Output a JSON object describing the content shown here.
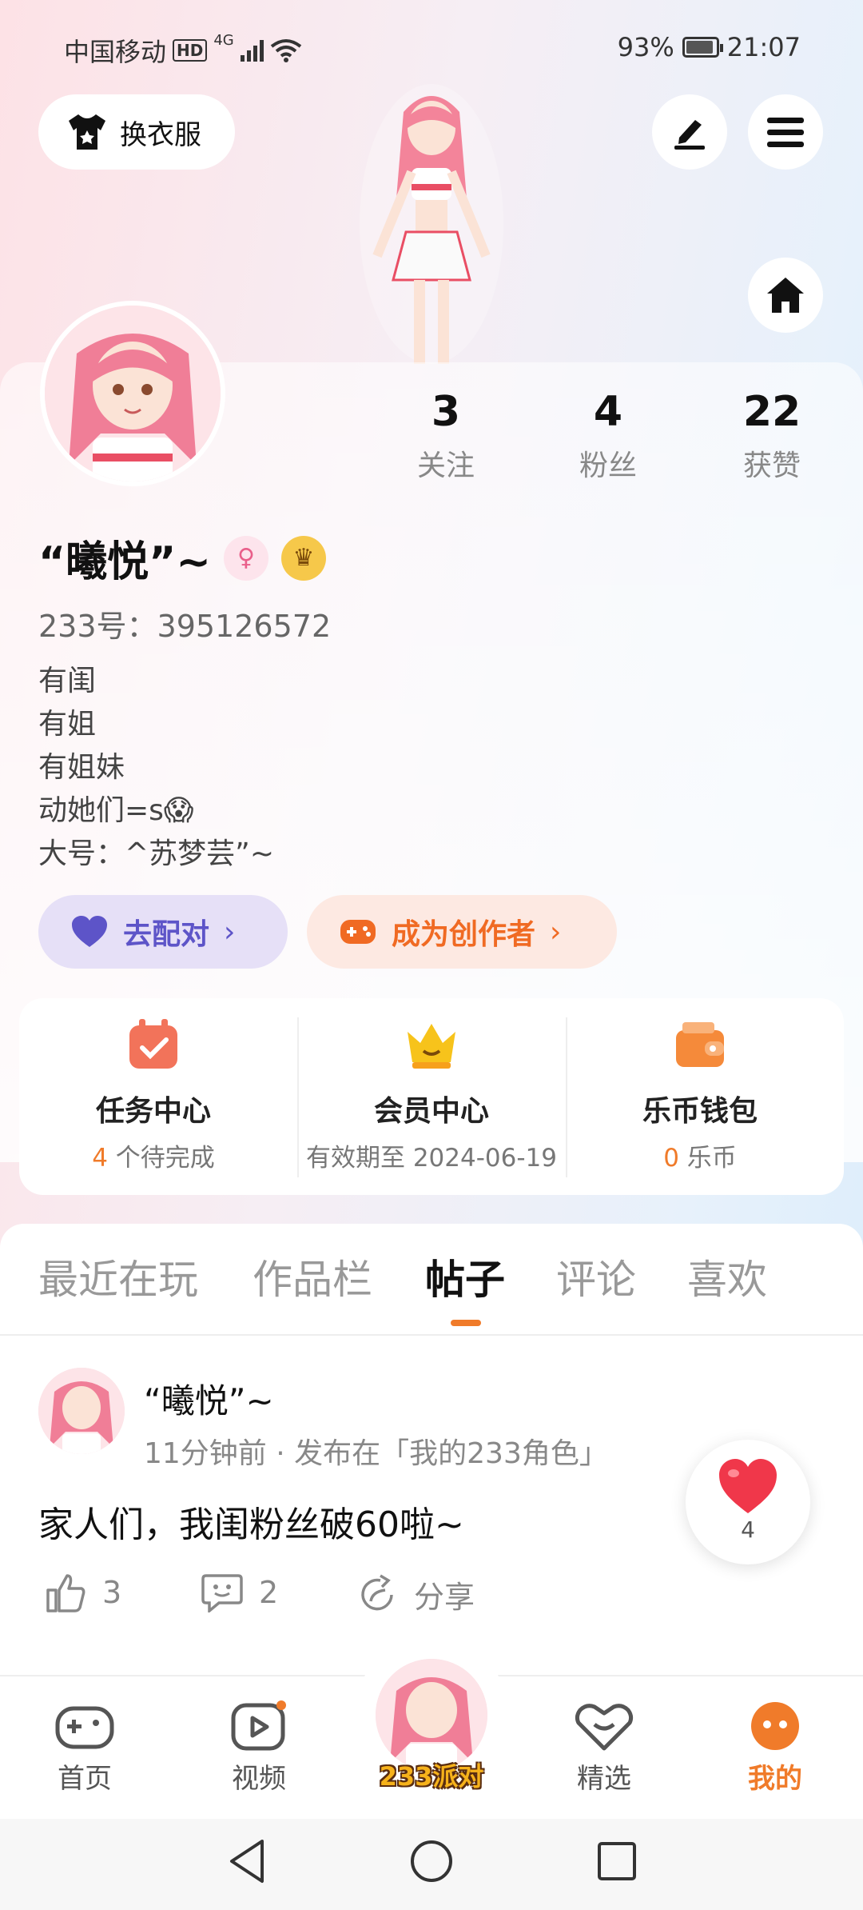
{
  "status": {
    "carrier": "中国移动",
    "hd": "HD",
    "net": "4G",
    "battery": "93%",
    "time": "21:07"
  },
  "header": {
    "outfit_label": "换衣服"
  },
  "profile": {
    "stats": [
      {
        "num": "3",
        "label": "关注"
      },
      {
        "num": "4",
        "label": "粉丝"
      },
      {
        "num": "22",
        "label": "获赞"
      }
    ],
    "name": "“曦悦”~",
    "uid": "233号：395126572",
    "bio": [
      "有闺",
      "有姐",
      "有姐妹",
      "动她们=s😱",
      "大号：^苏梦芸”~"
    ]
  },
  "actions": {
    "match": "去配对",
    "creator": "成为创作者"
  },
  "services": [
    {
      "title": "任务中心",
      "sub_num": "4",
      "sub_text": " 个待完成"
    },
    {
      "title": "会员中心",
      "sub_num": "",
      "sub_text": "有效期至 2024-06-19"
    },
    {
      "title": "乐币钱包",
      "sub_num": "0",
      "sub_text": " 乐币"
    }
  ],
  "tabs": [
    "最近在玩",
    "作品栏",
    "帖子",
    "评论",
    "喜欢"
  ],
  "post": {
    "author": "“曦悦”~",
    "meta": "11分钟前 · 发布在「我的233角色」",
    "text": "家人们，我闺粉丝破60啦~",
    "likes": "3",
    "comments": "2",
    "share": "分享",
    "float_likes": "4"
  },
  "nav": {
    "home": "首页",
    "video": "视频",
    "center": "233派对",
    "featured": "精选",
    "mine": "我的"
  },
  "colors": {
    "accent": "#f07b2a",
    "match": "#5d54c8"
  }
}
